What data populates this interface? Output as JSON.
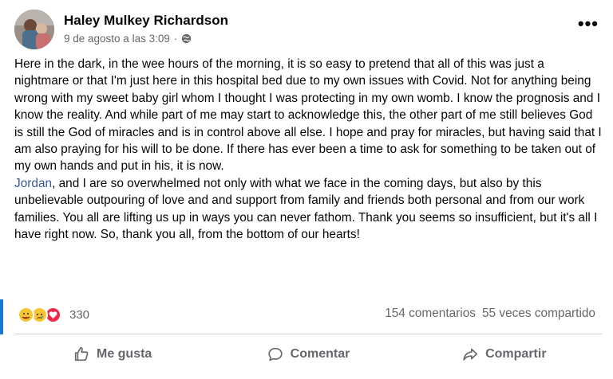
{
  "post": {
    "author": "Haley Mulkey Richardson",
    "date": "9 de agosto a las 3:09",
    "separator": "·",
    "audience_icon": "globe-icon",
    "more_label": "•••",
    "paragraph1": "Here in the dark, in the wee hours of the morning, it is so easy to pretend that all of this was just a nightmare or that I'm just here in this hospital bed due to my own issues with Covid. Not for anything being wrong with my sweet baby girl whom I thought I was protecting in my own womb. I know the prognosis and I know the reality. And while part of me may start to acknowledge this, the other part of me still believes God is still the God of miracles and is in control above all else. I hope and pray for miracles, but having said that I am also praying for his will to be done. If there has ever been a time to ask for something to be taken out of my own hands and put in his, it is now.",
    "mention": "Jordan",
    "paragraph2_rest": ", and I are so overwhelmed not only with what we face in the coming days, but also by this unbelievable outpouring of love and and support from family and friends both personal and from our work families. You all are lifting us up in ways you can never fathom. Thank you seems so insufficient, but it's all I have right now. So, thank you all, from the bottom of our hearts!"
  },
  "reactions": {
    "types": [
      "care",
      "sad",
      "love"
    ],
    "count": "330"
  },
  "stats": {
    "comments": "154 comentarios",
    "shares": "55 veces compartido"
  },
  "actions": {
    "like": "Me gusta",
    "comment": "Comentar",
    "share": "Compartir"
  },
  "colors": {
    "link": "#385898",
    "muted": "#65676b",
    "love": "#f0284a",
    "care": "#f7c531"
  }
}
